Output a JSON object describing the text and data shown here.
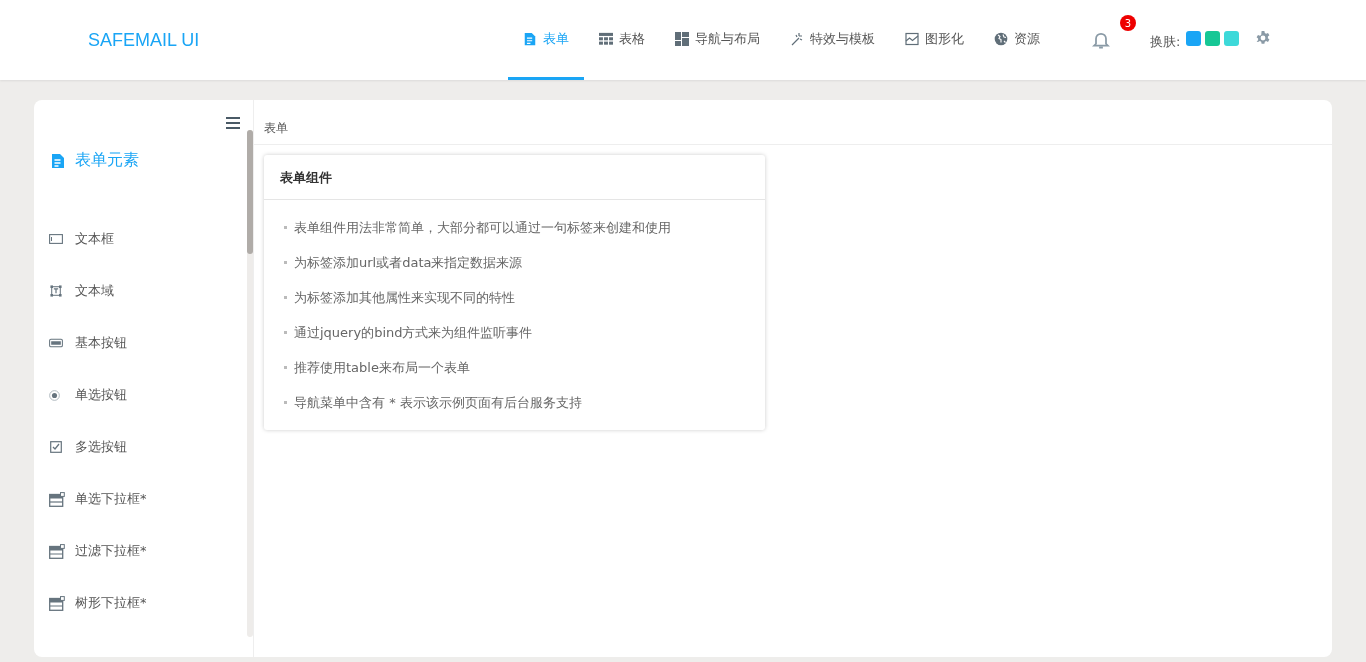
{
  "brand": "SAFEMAIL UI",
  "nav": [
    {
      "label": "表单",
      "kind": "form",
      "selected": true
    },
    {
      "label": "表格",
      "kind": "table",
      "selected": false
    },
    {
      "label": "导航与布局",
      "kind": "layout",
      "selected": false
    },
    {
      "label": "特效与模板",
      "kind": "effects",
      "selected": false
    },
    {
      "label": "图形化",
      "kind": "chart",
      "selected": false
    },
    {
      "label": "资源",
      "kind": "globe",
      "selected": false
    }
  ],
  "notifications": {
    "count": "3"
  },
  "skin": {
    "label": "换肤:",
    "swatches": [
      {
        "color": "#1aa5f5"
      },
      {
        "color": "#16c795"
      },
      {
        "color": "#3dd9d9"
      }
    ]
  },
  "sidebar": {
    "title": "表单元素",
    "items": [
      {
        "label": "文本框",
        "kind": "text-input"
      },
      {
        "label": "文本域",
        "kind": "textarea"
      },
      {
        "label": "基本按钮",
        "kind": "button"
      },
      {
        "label": "单选按钮",
        "kind": "radio"
      },
      {
        "label": "多选按钮",
        "kind": "checkbox"
      },
      {
        "label": "单选下拉框*",
        "kind": "dropdown"
      },
      {
        "label": "过滤下拉框*",
        "kind": "dropdown"
      },
      {
        "label": "树形下拉框*",
        "kind": "dropdown"
      }
    ]
  },
  "breadcrumb": "表单",
  "card": {
    "title": "表单组件",
    "items": [
      "表单组件用法非常简单，大部分都可以通过一句标签来创建和使用",
      "为标签添加url或者data来指定数据来源",
      "为标签添加其他属性来实现不同的特性",
      "通过jquery的bind方式来为组件监听事件",
      "推荐使用table来布局一个表单",
      "导航菜单中含有 * 表示该示例页面有后台服务支持"
    ]
  }
}
